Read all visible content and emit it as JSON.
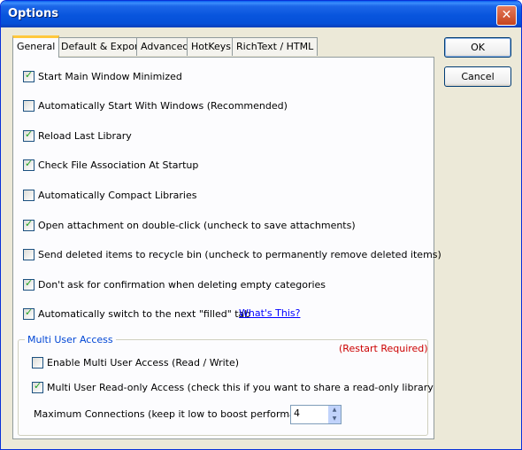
{
  "window": {
    "title": "Options",
    "close_label": "✕"
  },
  "tabs": [
    {
      "label": "General",
      "active": true
    },
    {
      "label": "Default & Export",
      "active": false
    },
    {
      "label": "Advanced",
      "active": false
    },
    {
      "label": "HotKeys",
      "active": false
    },
    {
      "label": "RichText / HTML",
      "active": false
    }
  ],
  "options": [
    {
      "label": "Start Main Window Minimized",
      "checked": true
    },
    {
      "label": "Automatically Start With Windows (Recommended)",
      "checked": false
    },
    {
      "label": "Reload Last Library",
      "checked": true
    },
    {
      "label": "Check File Association At Startup",
      "checked": true
    },
    {
      "label": "Automatically Compact Libraries",
      "checked": false
    },
    {
      "label": "Open attachment on double-click (uncheck to save attachments)",
      "checked": true
    },
    {
      "label": "Send deleted items to recycle bin (uncheck to permanently remove deleted items)",
      "checked": false
    },
    {
      "label": "Don't ask for confirmation when deleting empty categories",
      "checked": true
    },
    {
      "label": "Automatically switch to the next \"filled\" tab",
      "checked": true
    }
  ],
  "whats_this": "What's This?",
  "multi_user": {
    "group_title": "Multi User Access",
    "restart_note": "(Restart Required)",
    "enable": {
      "label": "Enable Multi User Access (Read / Write)",
      "checked": false
    },
    "read_only": {
      "label": "Multi User Read-only Access (check this if you want to share a read-only library",
      "checked": true
    },
    "max_conn_label": "Maximum Connections (keep it low to boost performance):",
    "max_conn_value": "4"
  },
  "buttons": {
    "ok": "OK",
    "cancel": "Cancel"
  }
}
